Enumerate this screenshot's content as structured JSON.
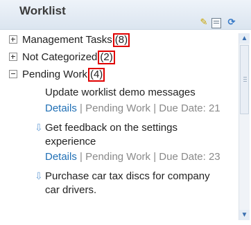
{
  "header": {
    "title": "Worklist"
  },
  "toolbar": {
    "edit_icon": "pencil-icon",
    "doc_icon": "document-icon",
    "refresh_icon": "refresh-icon"
  },
  "tree": {
    "nodes": [
      {
        "label": "Management Tasks",
        "count": "(8)",
        "state": "collapsed"
      },
      {
        "label": "Not Categorized",
        "count": "(2)",
        "state": "collapsed"
      },
      {
        "label": "Pending Work",
        "count": "(4)",
        "state": "expanded"
      }
    ],
    "tasks": [
      {
        "title": "Update worklist demo messages",
        "title2": "",
        "details": "Details",
        "meta": " | Pending Work | Due Date: 21"
      },
      {
        "title": "Get feedback on the settings",
        "title2": "experience",
        "details": "Details",
        "meta": " | Pending Work | Due Date: 23"
      },
      {
        "title": "Purchase car tax discs for company",
        "title2": "car drivers.",
        "details": "",
        "meta": ""
      }
    ]
  },
  "colors": {
    "highlight_box": "#e00000",
    "link": "#1f6fb5",
    "meta_text": "#8a8a8a"
  }
}
